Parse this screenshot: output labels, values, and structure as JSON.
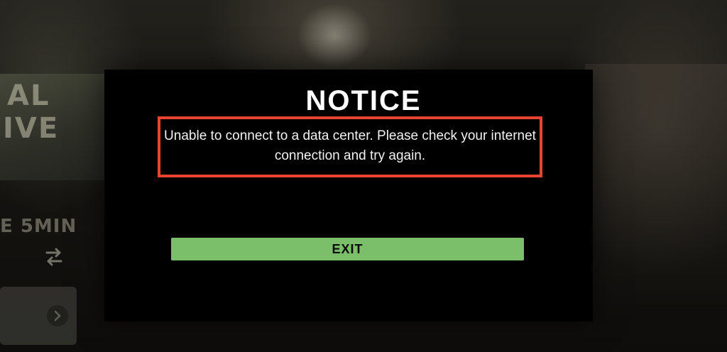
{
  "background": {
    "fragment_top_line1": "AL",
    "fragment_top_line2": "IVE",
    "fragment_mid": "E 5MIN"
  },
  "dialog": {
    "title": "NOTICE",
    "message": "Unable to connect to a data center. Please check your internet connection and try again.",
    "exit_label": "EXIT"
  },
  "colors": {
    "highlight_border": "#e8432f",
    "exit_button": "#7cbf6b",
    "dialog_bg": "#000000"
  },
  "icons": {
    "swap": "swap-arrows-icon",
    "card_arrow": "chevron-right-icon"
  }
}
